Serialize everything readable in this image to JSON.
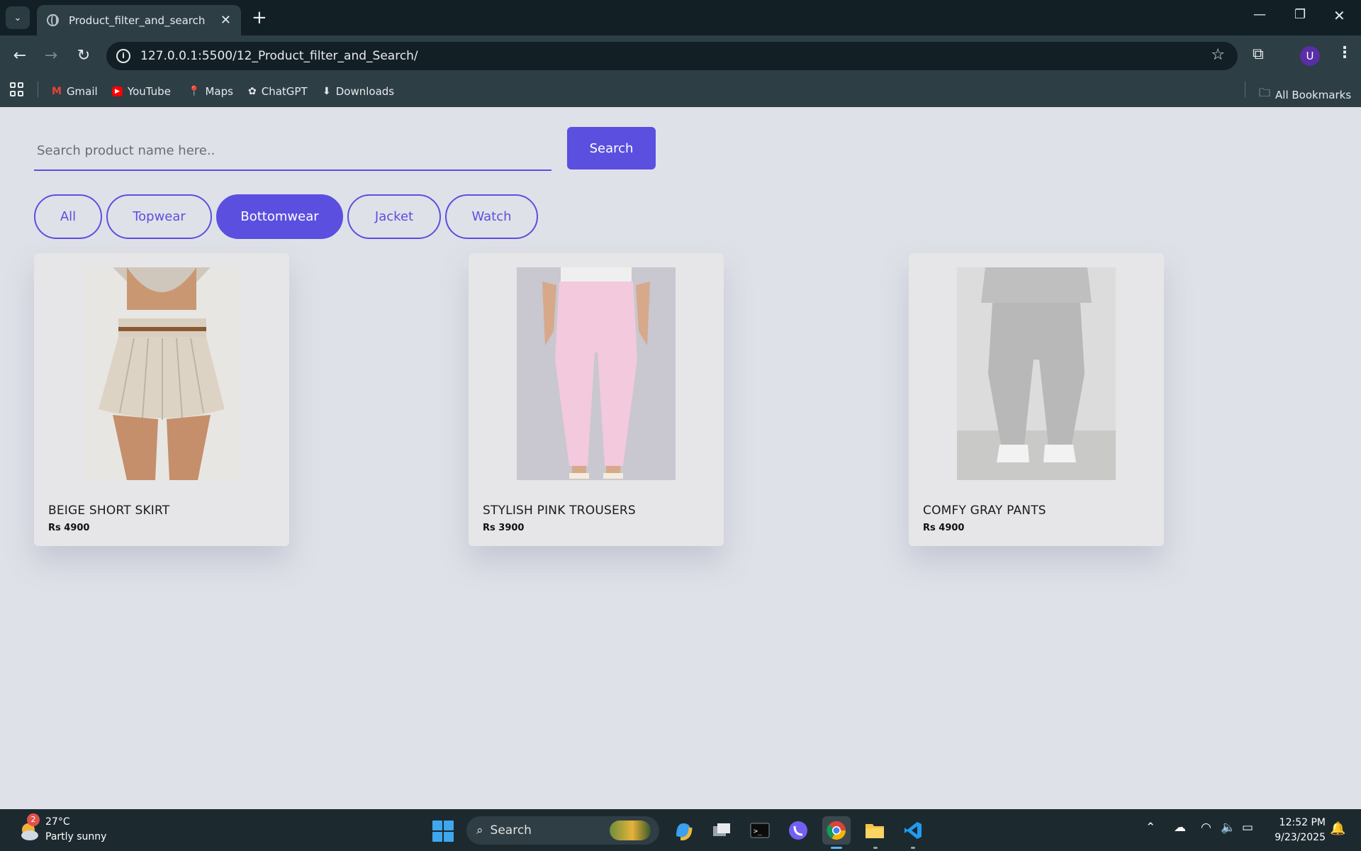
{
  "browser": {
    "tab_title": "Product_filter_and_search",
    "url": "127.0.0.1:5500/12_Product_filter_and_Search/",
    "profile_initial": "U",
    "bookmarks": [
      "Gmail",
      "YouTube",
      "Maps",
      "ChatGPT",
      "Downloads"
    ],
    "all_bookmarks": "All Bookmarks"
  },
  "page": {
    "search_placeholder": "Search product name here..",
    "search_button": "Search",
    "filters": [
      {
        "label": "All",
        "active": false
      },
      {
        "label": "Topwear",
        "active": false
      },
      {
        "label": "Bottomwear",
        "active": true
      },
      {
        "label": "Jacket",
        "active": false
      },
      {
        "label": "Watch",
        "active": false
      }
    ],
    "products": [
      {
        "name": "BEIGE SHORT SKIRT",
        "price": "Rs 4900"
      },
      {
        "name": "STYLISH PINK TROUSERS",
        "price": "Rs 3900"
      },
      {
        "name": "COMFY GRAY PANTS",
        "price": "Rs 4900"
      }
    ],
    "accent_color": "#5b4fe0"
  },
  "taskbar": {
    "weather_badge": "2",
    "weather_temp": "27°C",
    "weather_desc": "Partly sunny",
    "search_label": "Search",
    "time": "12:52 PM",
    "date": "9/23/2025"
  }
}
